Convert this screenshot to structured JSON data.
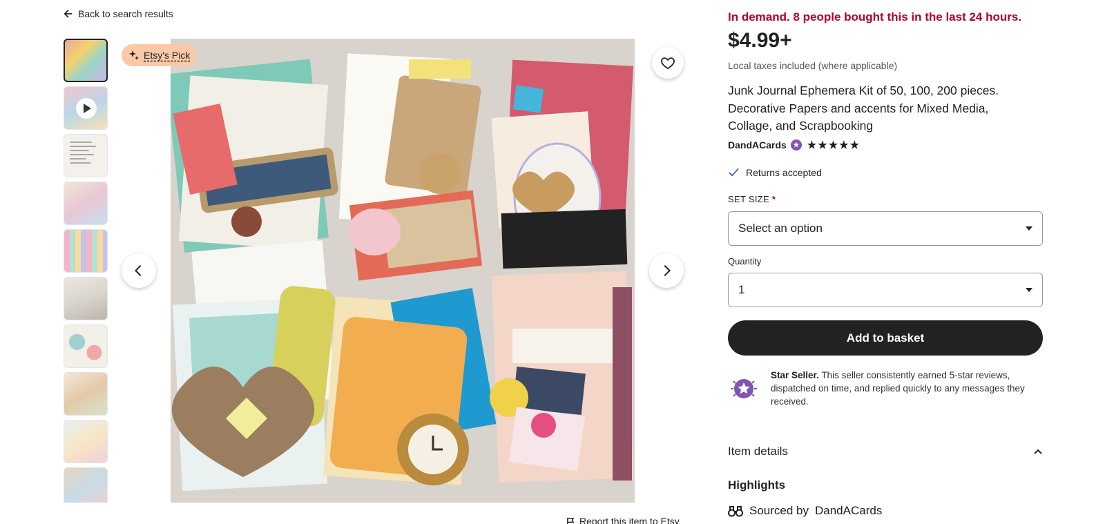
{
  "nav": {
    "back_label": "Back to search results"
  },
  "gallery": {
    "badge_label": "Etsy's Pick",
    "thumbnail_count": 10,
    "selected_thumbnail": 1,
    "video_thumbnail": 2
  },
  "report_label": "Report this item to Etsy",
  "product": {
    "demand_notice": "In demand. 8 people bought this in the last 24 hours.",
    "price": "$4.99+",
    "taxes_note": "Local taxes included (where applicable)",
    "title": "Junk Journal Ephemera Kit of 50, 100, 200 pieces. Decorative Papers and accents for Mixed Media, Collage, and Scrapbooking",
    "shop_name": "DandACards",
    "rating_stars": 5,
    "returns_label": "Returns accepted"
  },
  "options": {
    "set_size_label": "SET SIZE",
    "required_marker": "*",
    "set_size_value": "Select an option",
    "quantity_label": "Quantity",
    "quantity_value": "1"
  },
  "actions": {
    "add_to_basket": "Add to basket"
  },
  "star_seller": {
    "title": "Star Seller.",
    "description": "This seller consistently earned 5-star reviews, dispatched on time, and replied quickly to any messages they received."
  },
  "sections": {
    "item_details": "Item details",
    "highlights": "Highlights",
    "sourced_prefix": "Sourced by",
    "sourced_shop": "DandACards"
  },
  "colors": {
    "accent_red": "#b1012c",
    "badge_peach": "#f9c9a8",
    "star_seller_purple": "#7f54b3",
    "button_dark": "#222222"
  }
}
